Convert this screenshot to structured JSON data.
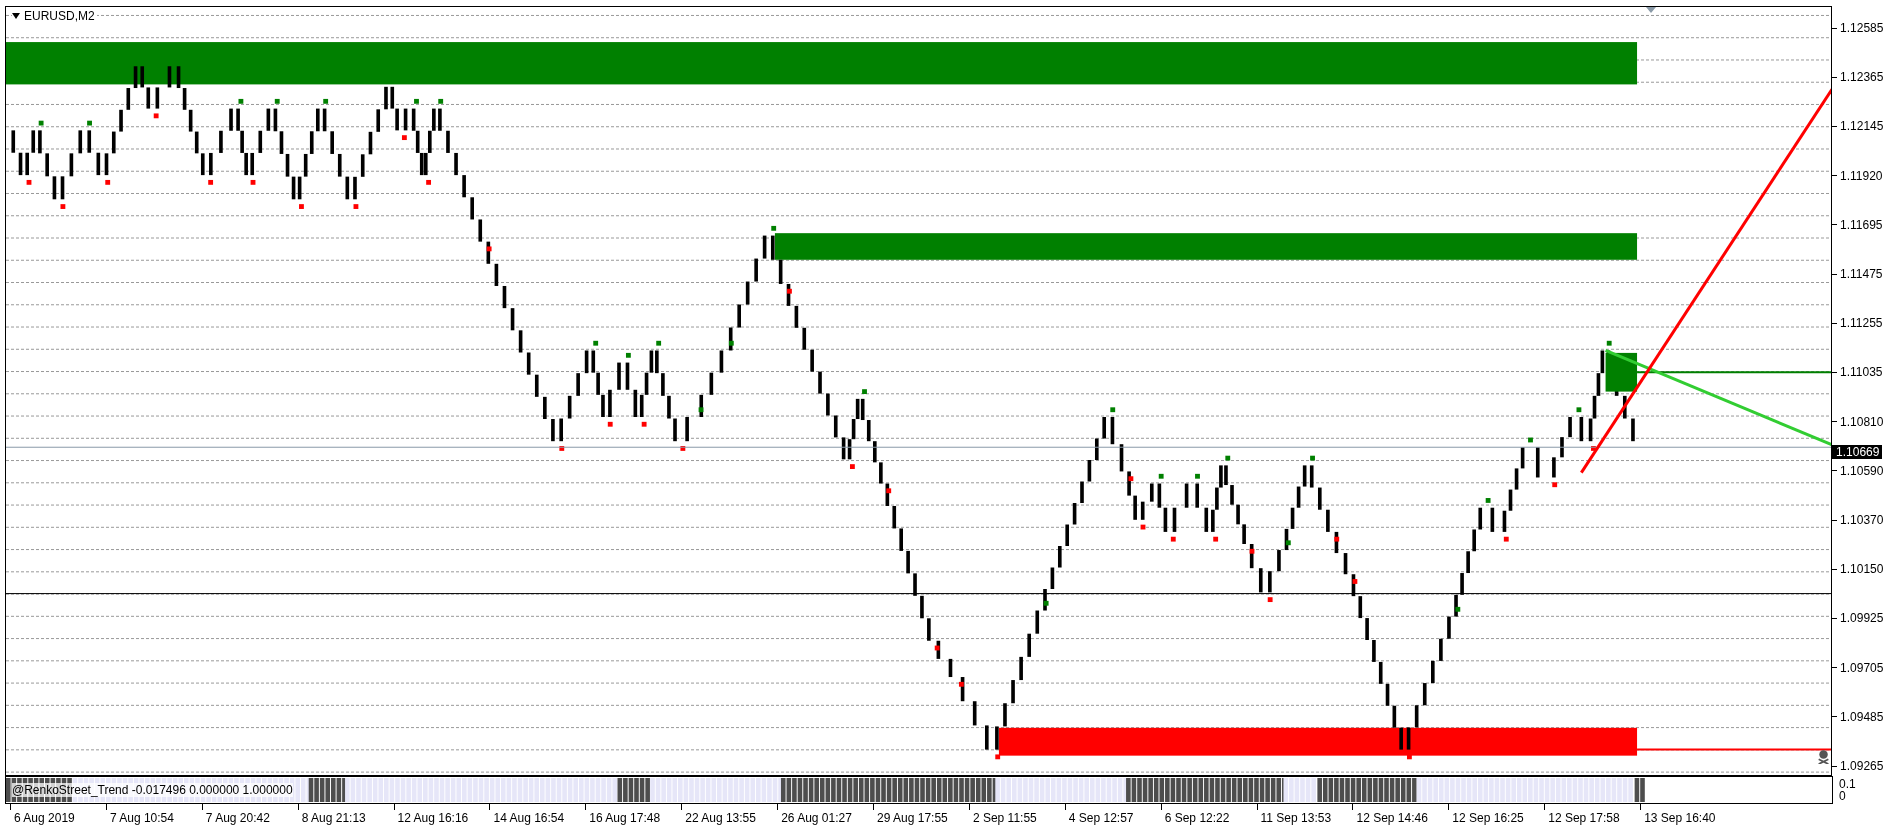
{
  "chart": {
    "title": "EURUSD,M2"
  },
  "price_axis": {
    "labels": [
      {
        "text": "1.12585",
        "kind": "level"
      },
      {
        "text": "1.12365",
        "kind": "level"
      },
      {
        "text": "1.12145",
        "kind": "level"
      },
      {
        "text": "1.11920",
        "kind": "level"
      },
      {
        "text": "1.11695",
        "kind": "level"
      },
      {
        "text": "1.11475",
        "kind": "level"
      },
      {
        "text": "1.11255",
        "kind": "level"
      },
      {
        "text": "1.11035",
        "kind": "level"
      },
      {
        "text": "1.10810",
        "kind": "level"
      },
      {
        "text": "1.10669",
        "kind": "current"
      },
      {
        "text": "1.10590",
        "kind": "level"
      },
      {
        "text": "1.10370",
        "kind": "level"
      },
      {
        "text": "1.10150",
        "kind": "level"
      },
      {
        "text": "1.09925",
        "kind": "level"
      },
      {
        "text": "1.09705",
        "kind": "level"
      },
      {
        "text": "1.09485",
        "kind": "level"
      },
      {
        "text": "1.09265",
        "kind": "level"
      }
    ]
  },
  "indicator": {
    "label": "@RenkoStreet_Trend -0.017496 0.000000 1.000000",
    "scale": [
      "0.1",
      "0"
    ]
  },
  "time_axis": {
    "labels": [
      "6 Aug 2019",
      "7 Aug 10:54",
      "7 Aug 20:42",
      "8 Aug 21:13",
      "12 Aug 16:16",
      "14 Aug 16:54",
      "16 Aug 17:48",
      "22 Aug 13:55",
      "26 Aug 01:27",
      "29 Aug 17:55",
      "2 Sep 11:55",
      "4 Sep 12:57",
      "6 Sep 12:22",
      "11 Sep 13:53",
      "12 Sep 14:46",
      "12 Sep 16:25",
      "12 Sep 17:58",
      "13 Sep 16:40"
    ]
  }
}
